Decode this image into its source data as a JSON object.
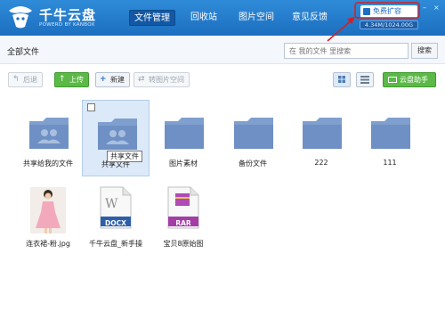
{
  "app": {
    "brand": "千牛云盘",
    "brand_sub": "POWERD BY KANBOX"
  },
  "nav": [
    {
      "label": "文件管理",
      "active": true
    },
    {
      "label": "回收站",
      "active": false
    },
    {
      "label": "图片空间",
      "active": false
    },
    {
      "label": "意见反馈",
      "active": false
    }
  ],
  "account": {
    "upgrade_label": "免费扩容",
    "quota": "4.34M/1024.00G"
  },
  "path": {
    "crumb": "全部文件"
  },
  "search": {
    "placeholder": "在 我的文件 里搜索",
    "button": "搜索"
  },
  "toolbar": {
    "back": "后退",
    "upload": "上传",
    "new": "新建",
    "convert": "转图片空间",
    "assistant": "云盘助手"
  },
  "files": [
    {
      "name": "共享给我的文件",
      "type": "shared-folder"
    },
    {
      "name": "共享文件",
      "type": "shared-folder",
      "selected": true,
      "tooltip": "共享文件"
    },
    {
      "name": "图片素材",
      "type": "folder"
    },
    {
      "name": "备份文件",
      "type": "folder"
    },
    {
      "name": "222",
      "type": "folder"
    },
    {
      "name": "111",
      "type": "folder"
    },
    {
      "name": "连衣裙-粉.jpg",
      "type": "image"
    },
    {
      "name": "千牛云盘_新手操",
      "type": "docx",
      "badge": "DOCX"
    },
    {
      "name": "宝贝8原始图",
      "type": "rar",
      "badge": "RAR"
    }
  ],
  "colors": {
    "topbar": "#1f74c6",
    "accent_green": "#5bb947",
    "folder": "#7f9fce",
    "annotation_red": "#d81e1e"
  }
}
